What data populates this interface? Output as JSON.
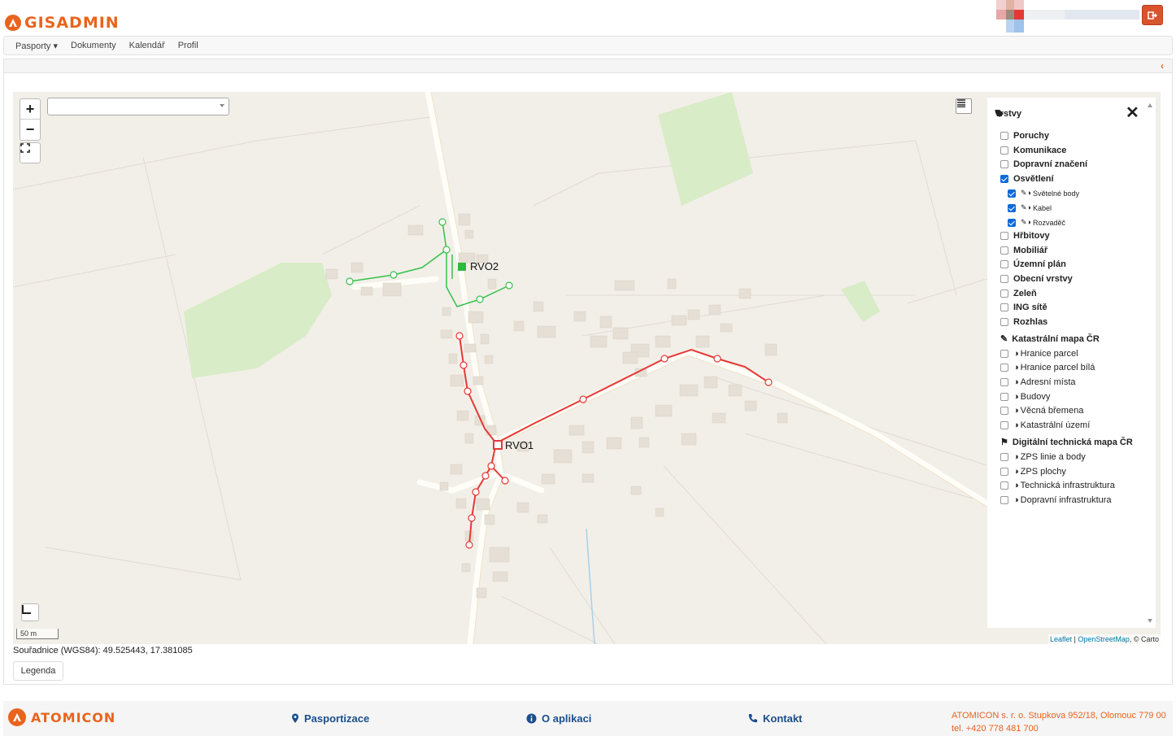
{
  "header": {
    "brand": "GISADMIN"
  },
  "nav": {
    "items": [
      "Pasporty",
      "Dokumenty",
      "Kalendář",
      "Profil"
    ]
  },
  "map": {
    "labels": {
      "rvo1": "RVO1",
      "rvo2": "RVO2"
    },
    "scale_label": "50 m",
    "attribution": {
      "leaflet": "Leaflet",
      "sep": " | ",
      "osm": "OpenStreetMap",
      "carto": ", © Carto"
    },
    "colors": {
      "lighting_cable_active": "#e53935",
      "lighting_cable_green": "#34c24a",
      "park": "#d8ecc7"
    }
  },
  "layers": {
    "title": "Vrstvy",
    "items": [
      {
        "label": "Poruchy",
        "checked": false
      },
      {
        "label": "Komunikace",
        "checked": false
      },
      {
        "label": "Dopravní značení",
        "checked": false
      },
      {
        "label": "Osvětlení",
        "checked": true
      },
      {
        "label": "Světelné body",
        "checked": true
      },
      {
        "label": "Kabel",
        "checked": true
      },
      {
        "label": "Rozvaděč",
        "checked": true
      },
      {
        "label": "Hřbitovy",
        "checked": false
      },
      {
        "label": "Mobiliář",
        "checked": false
      },
      {
        "label": "Územní plán",
        "checked": false
      },
      {
        "label": "Obecní vrstvy",
        "checked": false
      },
      {
        "label": "Zeleň",
        "checked": false
      },
      {
        "label": "ING sítě",
        "checked": false
      },
      {
        "label": "Rozhlas",
        "checked": false
      }
    ],
    "cadastre": {
      "title": "Katastrální mapa ČR",
      "items": [
        "Hranice parcel",
        "Hranice parcel bílá",
        "Adresní místa",
        "Budovy",
        "Věcná břemena",
        "Katastrální území"
      ]
    },
    "dtm": {
      "title": "Digitální technická mapa ČR",
      "items": [
        "ZPS linie a body",
        "ZPS plochy",
        "Technická infrastruktura",
        "Dopravní infrastruktura"
      ]
    }
  },
  "coords": {
    "text": "Souřadnice (WGS84): 49.525443, 17.381085"
  },
  "legend_button": "Legenda",
  "footer": {
    "brand": "ATOMICON",
    "links": [
      "Pasportizace",
      "O aplikaci",
      "Kontakt"
    ],
    "address": "ATOMICON s. r. o. Stupkova 952/18, Olomouc 779 00",
    "phone": "tel. +420 778 481 700"
  }
}
